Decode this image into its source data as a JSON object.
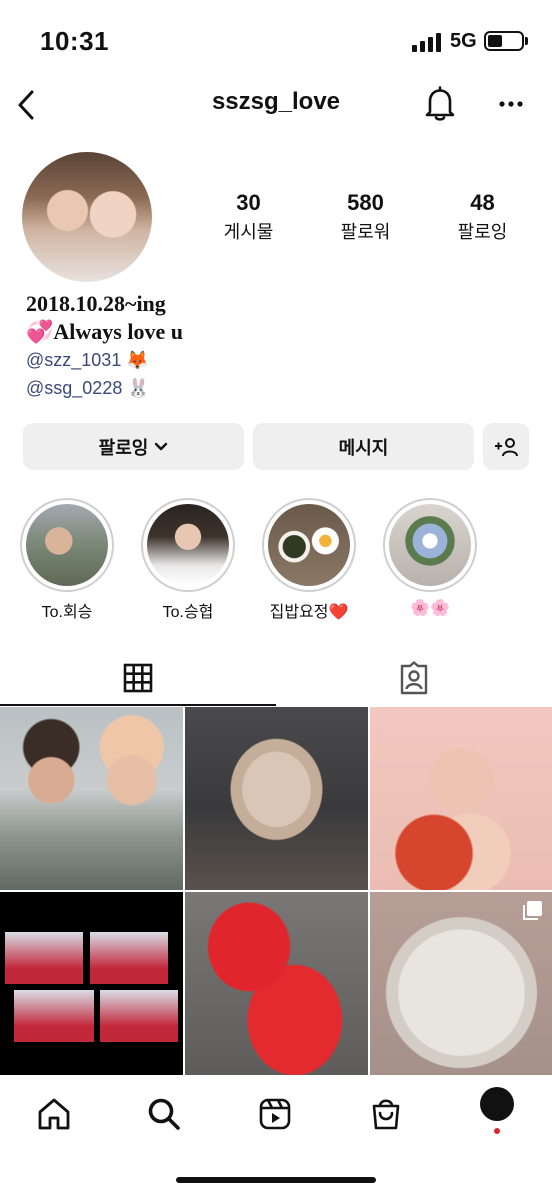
{
  "status_bar": {
    "time": "10:31",
    "network": "5G"
  },
  "header": {
    "username": "sszsg_love"
  },
  "profile": {
    "stats": [
      {
        "count": "30",
        "label": "게시물"
      },
      {
        "count": "580",
        "label": "팔로워"
      },
      {
        "count": "48",
        "label": "팔로잉"
      }
    ],
    "bio_lines": [
      "2018.10.28~ing",
      "💞Always love u"
    ],
    "links": [
      "@szz_1031 🦊",
      "@ssg_0228 🐰"
    ]
  },
  "actions": {
    "following_label": "팔로잉",
    "message_label": "메시지"
  },
  "highlights": [
    {
      "label": "To.회승"
    },
    {
      "label": "To.승협"
    },
    {
      "label": "집밥요정❤️"
    },
    {
      "label": "🌸🌸"
    }
  ],
  "tabs": [
    {
      "icon": "grid-icon",
      "active": true
    },
    {
      "icon": "tagged-icon",
      "active": false
    }
  ],
  "bottom_nav": [
    "home-icon",
    "search-icon",
    "reels-icon",
    "shop-icon",
    "profile-avatar"
  ]
}
